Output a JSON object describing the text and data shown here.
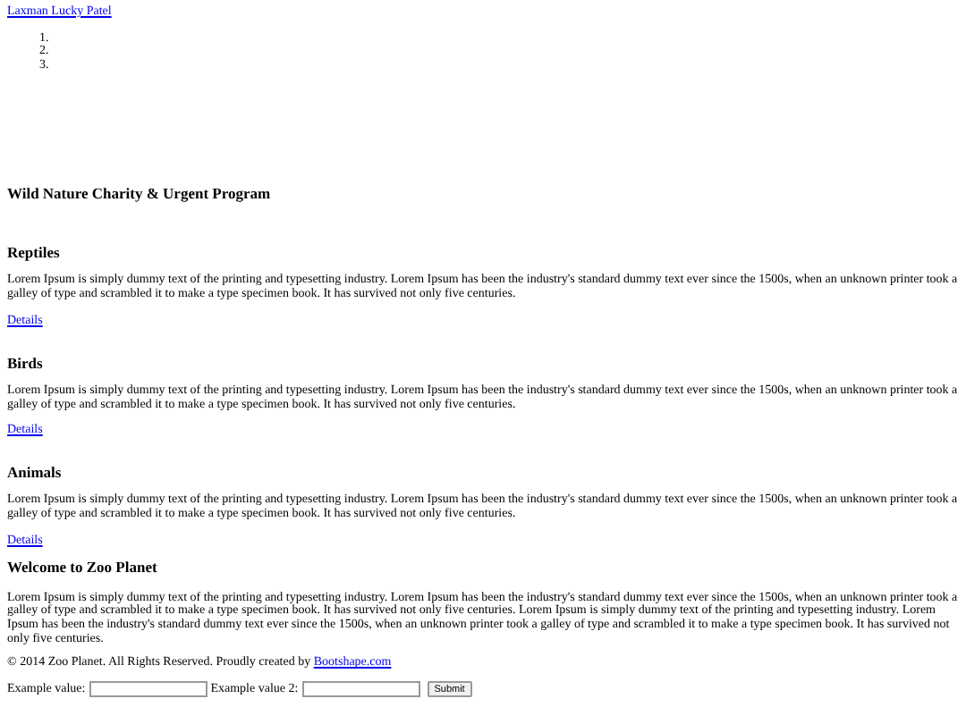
{
  "top_link": "Laxman Lucky Patel",
  "list_markers": [
    "1.",
    "2.",
    "3."
  ],
  "page_title": "Wild Nature Charity & Urgent Program",
  "sections": [
    {
      "heading": "Reptiles",
      "text": "Lorem Ipsum is simply dummy text of the printing and typesetting industry. Lorem Ipsum has been the industry's standard dummy text ever since the 1500s, when an unknown printer took a galley of type and scrambled it to make a type specimen book. It has survived not only five centuries.",
      "link": "Details"
    },
    {
      "heading": "Birds",
      "text": "Lorem Ipsum is simply dummy text of the printing and typesetting industry. Lorem Ipsum has been the industry's standard dummy text ever since the 1500s, when an unknown printer took a galley of type and scrambled it to make a type specimen book. It has survived not only five centuries.",
      "link": "Details"
    },
    {
      "heading": "Animals",
      "text": "Lorem Ipsum is simply dummy text of the printing and typesetting industry. Lorem Ipsum has been the industry's standard dummy text ever since the 1500s, when an unknown printer took a galley of type and scrambled it to make a type specimen book. It has survived not only five centuries.",
      "link": "Details"
    }
  ],
  "welcome": {
    "heading": "Welcome to Zoo Planet",
    "text": "Lorem Ipsum is simply dummy text of the printing and typesetting industry. Lorem Ipsum has been the industry's standard dummy text ever since the 1500s, when an unknown printer took a galley of type and scrambled it to make a type specimen book. It has survived not only five centuries. Lorem Ipsum is simply dummy text of the printing and typesetting industry. Lorem Ipsum has been the industry's standard dummy text ever since the 1500s, when an unknown printer took a galley of type and scrambled it to make a type specimen book. It has survived not only five centuries."
  },
  "footer": {
    "text": "© 2014 Zoo Planet. All Rights Reserved. Proudly created by",
    "link": "Bootshape.com"
  },
  "form": {
    "label_1": "Example value:",
    "label_2": "Example value 2:",
    "submit": "Submit"
  }
}
